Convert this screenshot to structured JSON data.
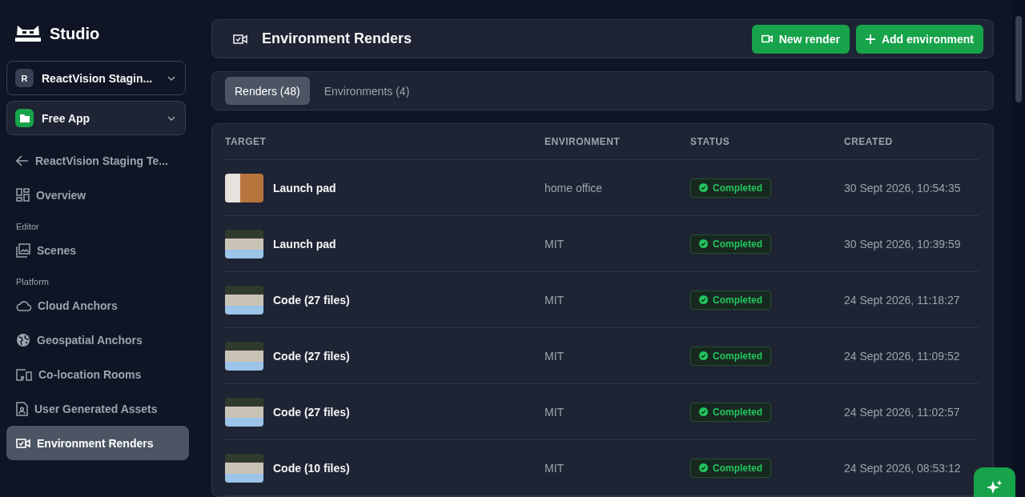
{
  "sidebar": {
    "brand": "Studio",
    "org_selector": {
      "initial": "R",
      "label": "ReactVision Stagin..."
    },
    "app_selector": {
      "label": "Free App"
    },
    "back_link": "ReactVision Staging Te...",
    "sections": [
      {
        "items": [
          {
            "label": "Overview",
            "selected": false
          }
        ]
      },
      {
        "heading": "Editor",
        "items": [
          {
            "label": "Scenes",
            "selected": false
          }
        ]
      },
      {
        "heading": "Platform",
        "items": [
          {
            "label": "Cloud Anchors",
            "selected": false
          },
          {
            "label": "Geospatial Anchors",
            "selected": false
          },
          {
            "label": "Co-location Rooms",
            "selected": false
          },
          {
            "label": "User Generated Assets",
            "selected": false
          },
          {
            "label": "Environment Renders",
            "selected": true
          }
        ]
      }
    ]
  },
  "page": {
    "title": "Environment Renders",
    "buttons": [
      {
        "label": "New render"
      },
      {
        "label": "Add environment"
      }
    ]
  },
  "tabs": [
    {
      "label": "Renders (48)",
      "selected": true
    },
    {
      "label": "Environments (4)",
      "selected": false
    }
  ],
  "table": {
    "columns": [
      "TARGET",
      "ENVIRONMENT",
      "STATUS",
      "CREATED"
    ],
    "rows": [
      {
        "target": "Launch pad",
        "environment": "home office",
        "status": "Completed",
        "kind": "completed",
        "created": "30 Sept 2026, 10:54:35"
      },
      {
        "target": "Launch pad",
        "environment": "MIT",
        "status": "Completed",
        "kind": "completed",
        "created": "30 Sept 2026, 10:39:59"
      },
      {
        "target": "Code (27 files)",
        "environment": "MIT",
        "status": "Completed",
        "kind": "completed",
        "created": "24 Sept 2026, 11:18:27"
      },
      {
        "target": "Code (27 files)",
        "environment": "MIT",
        "status": "Completed",
        "kind": "completed",
        "created": "24 Sept 2026, 11:09:52"
      },
      {
        "target": "Code (27 files)",
        "environment": "MIT",
        "status": "Completed",
        "kind": "completed",
        "created": "24 Sept 2026, 11:02:57"
      },
      {
        "target": "Code (10 files)",
        "environment": "MIT",
        "status": "Completed",
        "kind": "completed",
        "created": "24 Sept 2026, 08:53:12"
      }
    ]
  }
}
